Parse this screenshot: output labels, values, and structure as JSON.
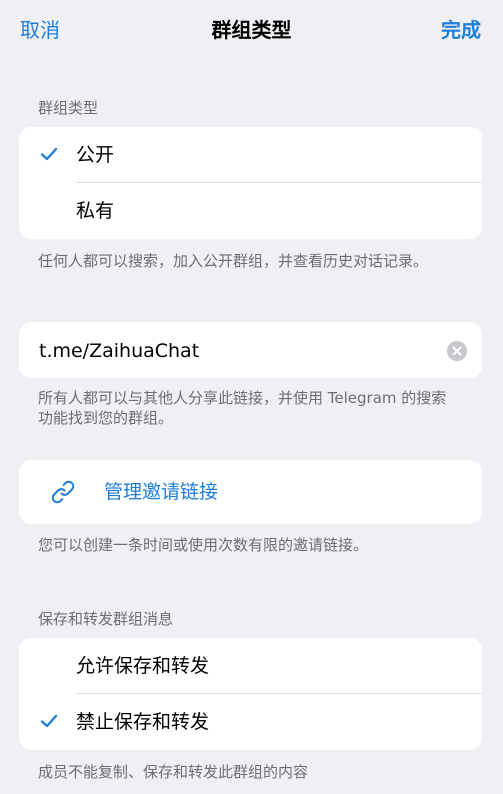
{
  "nav": {
    "cancel": "取消",
    "title": "群组类型",
    "done": "完成"
  },
  "group_type": {
    "header": "群组类型",
    "options": [
      {
        "label": "公开",
        "selected": true
      },
      {
        "label": "私有",
        "selected": false
      }
    ],
    "footer": "任何人都可以搜索，加入公开群组，并查看历史对话记录。"
  },
  "link": {
    "value": "t.me/ZaihuaChat",
    "footer": "所有人都可以与其他人分享此链接，并使用 Telegram 的搜索功能找到您的群组。"
  },
  "invite": {
    "label": "管理邀请链接",
    "footer": "您可以创建一条时间或使用次数有限的邀请链接。"
  },
  "forwarding": {
    "header": "保存和转发群组消息",
    "options": [
      {
        "label": "允许保存和转发",
        "selected": false
      },
      {
        "label": "禁止保存和转发",
        "selected": true
      }
    ],
    "footer": "成员不能复制、保存和转发此群组的内容"
  },
  "colors": {
    "accent": "#1e7fd8",
    "background": "#efeff4",
    "secondary_text": "#6d6d72"
  },
  "icons": {
    "check": "checkmark-icon",
    "clear": "clear-x-circle-icon",
    "link": "link-chain-icon"
  }
}
